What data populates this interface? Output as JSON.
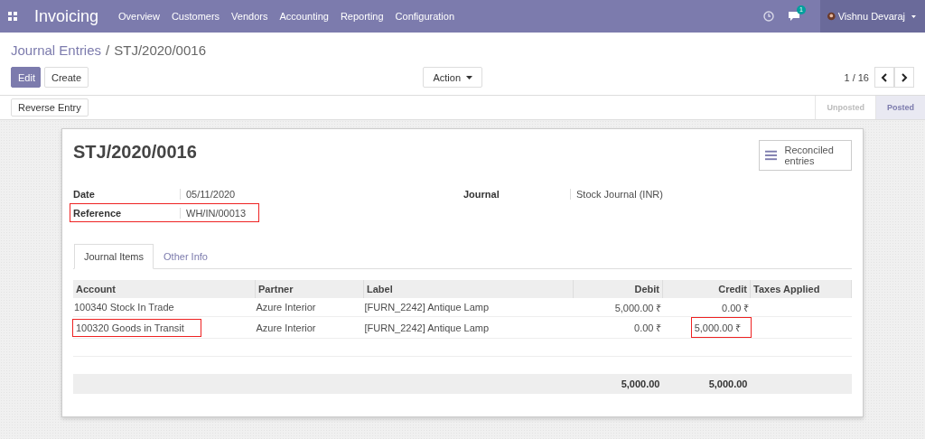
{
  "navbar": {
    "app_name": "Invoicing",
    "menu": [
      "Overview",
      "Customers",
      "Vendors",
      "Accounting",
      "Reporting",
      "Configuration"
    ],
    "message_count": "1",
    "user": "Vishnu Devaraj"
  },
  "breadcrumb": {
    "parent": "Journal Entries",
    "separator": "/",
    "current": "STJ/2020/0016"
  },
  "buttons": {
    "edit": "Edit",
    "create": "Create",
    "action": "Action"
  },
  "pager": {
    "text": "1 / 16"
  },
  "header": {
    "button": "Reverse Entry",
    "stages": [
      {
        "label": "Unposted",
        "selected": false
      },
      {
        "label": "Posted",
        "selected": true
      }
    ]
  },
  "sheet": {
    "title": "STJ/2020/0016",
    "smart_button": "Reconciled entries",
    "fields_left": [
      {
        "label": "Date",
        "value": "05/11/2020",
        "highlighted": false
      },
      {
        "label": "Reference",
        "value": "WH/IN/00013",
        "highlighted": true
      }
    ],
    "fields_right": [
      {
        "label": "Journal",
        "value": "Stock Journal (INR)",
        "highlighted": false
      }
    ],
    "tabs": [
      {
        "label": "Journal Items",
        "selected": true
      },
      {
        "label": "Other Info",
        "selected": false
      }
    ],
    "table": {
      "columns": [
        "Account",
        "Partner",
        "Label",
        "Debit",
        "Credit",
        "Taxes Applied"
      ],
      "rows": [
        [
          {
            "text": "100340 Stock In Trade",
            "highlighted": false
          },
          {
            "text": "Azure Interior",
            "highlighted": false
          },
          {
            "text": "[FURN_2242] Antique Lamp",
            "highlighted": false
          },
          {
            "text": "5,000.00 ₹",
            "highlighted": false
          },
          {
            "text": "0.00 ₹",
            "highlighted": false
          }
        ],
        [
          {
            "text": "100320 Goods in Transit",
            "highlighted": true
          },
          {
            "text": "Azure Interior",
            "highlighted": false
          },
          {
            "text": "[FURN_2242] Antique Lamp",
            "highlighted": false
          },
          {
            "text": "0.00 ₹",
            "highlighted": false
          },
          {
            "text": "5,000.00 ₹",
            "highlighted": true
          }
        ]
      ],
      "totals": {
        "debit": "5,000.00",
        "credit": "5,000.00"
      }
    }
  }
}
